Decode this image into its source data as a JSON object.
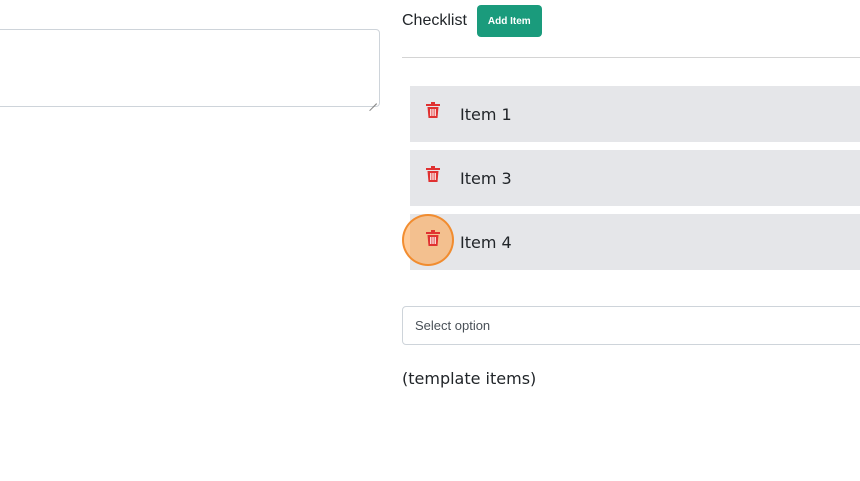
{
  "checklist": {
    "title": "Checklist",
    "add_button_label": "Add Item",
    "items": [
      {
        "label": "Item 1"
      },
      {
        "label": "Item 3"
      },
      {
        "label": "Item 4"
      }
    ]
  },
  "select": {
    "placeholder": "Select option"
  },
  "template_note": "(template items)",
  "colors": {
    "accent_green": "#1a9b7c",
    "delete_red": "#e03131",
    "item_background": "#e5e6e9",
    "click_highlight": "#ffa046"
  },
  "icons": {
    "delete": "trash-icon"
  }
}
